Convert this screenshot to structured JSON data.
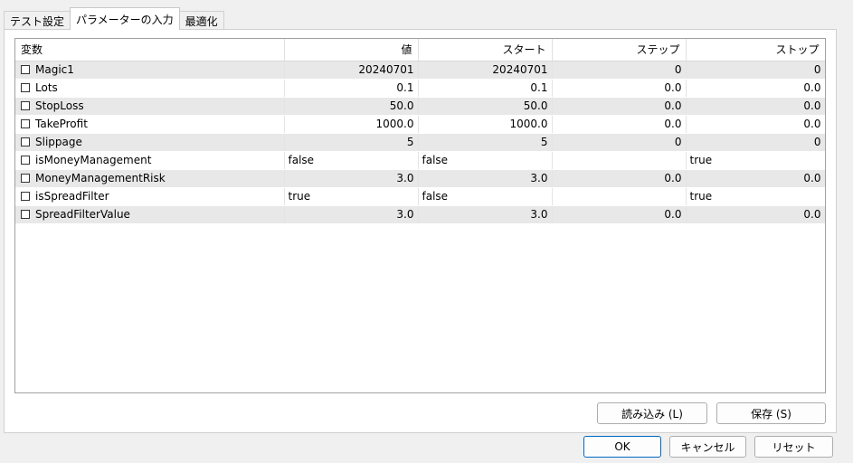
{
  "tabs": [
    {
      "label": "テスト設定"
    },
    {
      "label": "パラメーターの入力"
    },
    {
      "label": "最適化"
    }
  ],
  "table": {
    "headers": [
      "変数",
      "値",
      "スタート",
      "ステップ",
      "ストップ"
    ],
    "rows": [
      {
        "name": "Magic1",
        "value": "20240701",
        "start": "20240701",
        "step": "0",
        "stop": "0"
      },
      {
        "name": "Lots",
        "value": "0.1",
        "start": "0.1",
        "step": "0.0",
        "stop": "0.0"
      },
      {
        "name": "StopLoss",
        "value": "50.0",
        "start": "50.0",
        "step": "0.0",
        "stop": "0.0"
      },
      {
        "name": "TakeProfit",
        "value": "1000.0",
        "start": "1000.0",
        "step": "0.0",
        "stop": "0.0"
      },
      {
        "name": "Slippage",
        "value": "5",
        "start": "5",
        "step": "0",
        "stop": "0"
      },
      {
        "name": "isMoneyManagement",
        "value": "false",
        "start": "false",
        "step": "",
        "stop": "true"
      },
      {
        "name": "MoneyManagementRisk",
        "value": "3.0",
        "start": "3.0",
        "step": "0.0",
        "stop": "0.0"
      },
      {
        "name": "isSpreadFilter",
        "value": "true",
        "start": "false",
        "step": "",
        "stop": "true"
      },
      {
        "name": "SpreadFilterValue",
        "value": "3.0",
        "start": "3.0",
        "step": "0.0",
        "stop": "0.0"
      }
    ]
  },
  "buttons": {
    "load": "読み込み (L)",
    "save": "保存 (S)",
    "ok": "OK",
    "cancel": "キャンセル",
    "reset": "リセット"
  }
}
